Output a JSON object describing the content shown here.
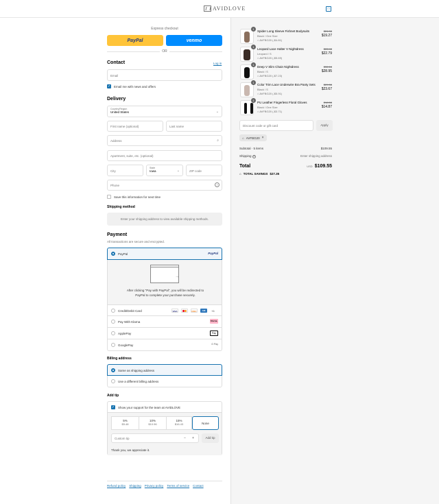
{
  "header": {
    "logo_text": "AVIDLOVE",
    "cart_icon": "shopping-bag-icon"
  },
  "express": {
    "label": "Express checkout",
    "paypal": "PayPal",
    "venmo": "venmo",
    "or": "OR"
  },
  "contact": {
    "title": "Contact",
    "login": "Log in",
    "email_placeholder": "Email",
    "news_label": "Email me with news and offers"
  },
  "delivery": {
    "title": "Delivery",
    "country_label": "Country/Region",
    "country_value": "United States",
    "first_name": "First name (optional)",
    "last_name": "Last name",
    "address": "Address",
    "apartment": "Apartment, suite, etc. (optional)",
    "city": "City",
    "state_label": "State",
    "state_value": "Iowa",
    "zip": "ZIP code",
    "phone": "Phone",
    "save_label": "Save this information for next time"
  },
  "shipping": {
    "title": "Shipping method",
    "note": "Enter your shipping address to view available shipping methods."
  },
  "payment": {
    "title": "Payment",
    "subtitle": "All transactions are secure and encrypted.",
    "paypal_label": "PayPal",
    "paypal_logo": "PayPal",
    "redirect_text_1": "After clicking \"Pay with PayPal\", you will be redirected to",
    "redirect_text_2": "PayPal to complete your purchase securely.",
    "card_label": "Credit/Debit Card",
    "card_more": "+6",
    "klarna_label": "Pay With Klarna",
    "klarna_logo": "Klarna.",
    "applepay_label": "ApplePay",
    "applepay_logo": "Pay",
    "googlepay_label": "GooglePay",
    "googlepay_logo": "G Pay"
  },
  "billing": {
    "title": "Billing address",
    "same": "Same as shipping address",
    "different": "Use a different billing address"
  },
  "tip": {
    "title": "Add tip",
    "support_label": "Show your support for the team at AVIDLOVE",
    "options": [
      {
        "pct": "5%",
        "amt": "$5.48"
      },
      {
        "pct": "10%",
        "amt": "$10.96"
      },
      {
        "pct": "15%",
        "amt": "$16.43"
      },
      {
        "pct": "None",
        "amt": ""
      }
    ],
    "custom_placeholder": "Custom tip",
    "minus": "−",
    "plus": "+",
    "add_button": "Add tip",
    "thanks": "Thank you, we appreciate it."
  },
  "footer": {
    "links": [
      "Refund policy",
      "Shipping",
      "Privacy policy",
      "Terms of service",
      "Contact"
    ]
  },
  "cart": {
    "items": [
      {
        "qty": "1",
        "name": "Spider Long Sleeve Fishnet Bodysuits",
        "variant": "Black / One Size",
        "discount": "AVFBG20 (-$4.81)",
        "old": "$24.08",
        "new": "$19.27"
      },
      {
        "qty": "1",
        "name": "Leopard Lace Halter V Nightdress",
        "variant": "Leopard / S",
        "discount": "AVFBG20 (-$5.69)",
        "old": "$28.48",
        "new": "$22.79"
      },
      {
        "qty": "1",
        "name": "Deep V Slim Chain Nightdress",
        "variant": "Black / S",
        "discount": "AVFBG20 (-$7.23)",
        "old": "$36.18",
        "new": "$28.95"
      },
      {
        "qty": "1",
        "name": "Color Trim Lace Underwire Bra Panty Sets",
        "variant": "Black / S",
        "discount": "AVFBG20 (-$5.91)",
        "old": "$29.58",
        "new": "$23.67"
      },
      {
        "qty": "1",
        "name": "PU Leather Fingerless Floral Gloves",
        "variant": "Black / One Size",
        "discount": "AVFBG20 (-$3.71)",
        "old": "$18.58",
        "new": "$14.87"
      }
    ],
    "discount_placeholder": "Discount code or gift card",
    "apply": "Apply",
    "applied_code": "AVFBG20",
    "subtotal_label": "Subtotal · 5 items",
    "subtotal_value": "$109.55",
    "shipping_label": "Shipping",
    "shipping_value": "Enter shipping address",
    "total_label": "Total",
    "currency": "USD",
    "total_value": "$109.55",
    "savings_label": "TOTAL SAVINGS",
    "savings_value": "$27.35"
  }
}
